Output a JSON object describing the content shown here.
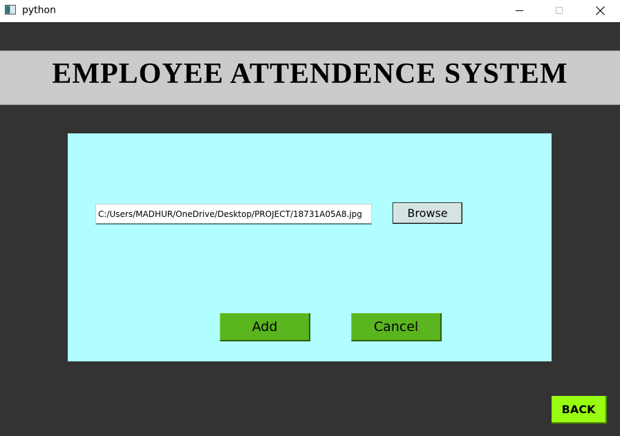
{
  "window": {
    "title": "python",
    "icon": "python-app-icon",
    "controls": {
      "minimize_icon": "minimize-icon",
      "maximize_icon": "maximize-icon",
      "close_icon": "close-icon"
    }
  },
  "header": {
    "title": "EMPLOYEE ATTENDENCE SYSTEM"
  },
  "form": {
    "file_path": {
      "value": "C:/Users/MADHUR/OneDrive/Desktop/PROJECT/18731A05A8.jpg"
    },
    "browse_label": "Browse",
    "add_label": "Add",
    "cancel_label": "Cancel"
  },
  "footer": {
    "back_label": "BACK"
  },
  "colors": {
    "background": "#333333",
    "header_band": "#cbcbcb",
    "panel": "#b0feff",
    "action_button": "#5ab51e",
    "back_button": "#98fd10",
    "browse_button": "#d6e3e3"
  }
}
